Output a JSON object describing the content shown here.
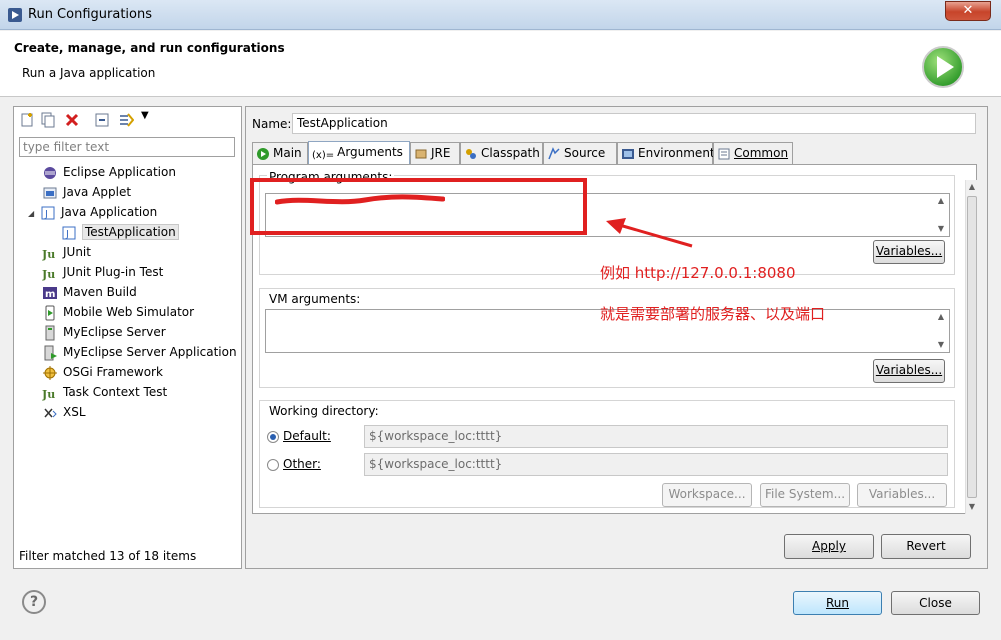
{
  "window": {
    "title": "Run Configurations",
    "close_glyph": "✕"
  },
  "header": {
    "title": "Create, manage, and run configurations",
    "subtitle": "Run a Java application"
  },
  "left": {
    "filter_placeholder": "type filter text",
    "tree": [
      {
        "label": "Eclipse Application",
        "icon": "eclipse-app-icon"
      },
      {
        "label": "Java Applet",
        "icon": "java-applet-icon"
      },
      {
        "label": "Java Application",
        "icon": "java-app-icon",
        "expanded": true
      },
      {
        "label": "TestApplication",
        "icon": "java-config-icon",
        "selected": true
      },
      {
        "label": "JUnit",
        "icon": "junit-icon"
      },
      {
        "label": "JUnit Plug-in Test",
        "icon": "junit-plugin-icon"
      },
      {
        "label": "Maven Build",
        "icon": "maven-icon"
      },
      {
        "label": "Mobile Web Simulator",
        "icon": "mobile-web-icon"
      },
      {
        "label": "MyEclipse Server",
        "icon": "server-icon"
      },
      {
        "label": "MyEclipse Server Application",
        "icon": "server-app-icon"
      },
      {
        "label": "OSGi Framework",
        "icon": "osgi-icon"
      },
      {
        "label": "Task Context Test",
        "icon": "task-context-icon"
      },
      {
        "label": "XSL",
        "icon": "xsl-icon"
      }
    ],
    "status": "Filter matched 13 of 18 items"
  },
  "right": {
    "name_label": "Name:",
    "name_value": "TestApplication",
    "tabs": [
      {
        "label": "Main",
        "icon": "main-tab-icon"
      },
      {
        "label": "Arguments",
        "icon": "arguments-tab-icon",
        "active": true
      },
      {
        "label": "JRE",
        "icon": "jre-tab-icon"
      },
      {
        "label": "Classpath",
        "icon": "classpath-tab-icon"
      },
      {
        "label": "Source",
        "icon": "source-tab-icon"
      },
      {
        "label": "Environment",
        "icon": "environment-tab-icon"
      },
      {
        "label": "Common",
        "icon": "common-tab-icon"
      }
    ],
    "program_args_label": "Program arguments:",
    "vm_args_label": "VM arguments:",
    "variables_label": "Variables...",
    "working_dir_label": "Working directory:",
    "default_label": "Default:",
    "other_label": "Other:",
    "default_value": "${workspace_loc:tttt}",
    "other_value": "${workspace_loc:tttt}",
    "workspace_btn": "Workspace...",
    "filesystem_btn": "File System...",
    "variables_btn": "Variables...",
    "apply_btn": "Apply",
    "revert_btn": "Revert"
  },
  "annotation": {
    "line1": "例如 http://127.0.0.1:8080",
    "line2": "就是需要部署的服务器、以及端口",
    "color": "#e02020"
  },
  "footer": {
    "help_glyph": "?",
    "run_btn": "Run",
    "close_btn": "Close"
  }
}
